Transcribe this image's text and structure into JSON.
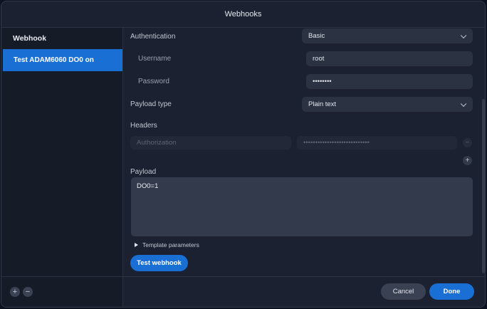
{
  "window": {
    "title": "Webhooks"
  },
  "sidebar": {
    "header": "Webhook",
    "items": [
      {
        "label": "Test ADAM6060 DO0 on",
        "selected": true
      }
    ],
    "add_label": "+",
    "remove_label": "−"
  },
  "form": {
    "authentication": {
      "label": "Authentication",
      "value": "Basic"
    },
    "username": {
      "label": "Username",
      "value": "root"
    },
    "password": {
      "label": "Password",
      "value": "••••••••"
    },
    "payload_type": {
      "label": "Payload type",
      "value": "Plain text"
    },
    "headers": {
      "label": "Headers",
      "key_placeholder": "Authorization",
      "value_placeholder": "••••••••••••••••••••••••••••",
      "remove_label": "−",
      "add_label": "+"
    },
    "payload": {
      "label": "Payload",
      "value": "DO0=1"
    },
    "template_parameters": {
      "label": "Template parameters",
      "expanded": false
    },
    "test_button": "Test webhook"
  },
  "footer": {
    "cancel": "Cancel",
    "done": "Done"
  },
  "colors": {
    "accent": "#1a6fd4",
    "background": "#1b2130",
    "field": "#2b3242"
  }
}
